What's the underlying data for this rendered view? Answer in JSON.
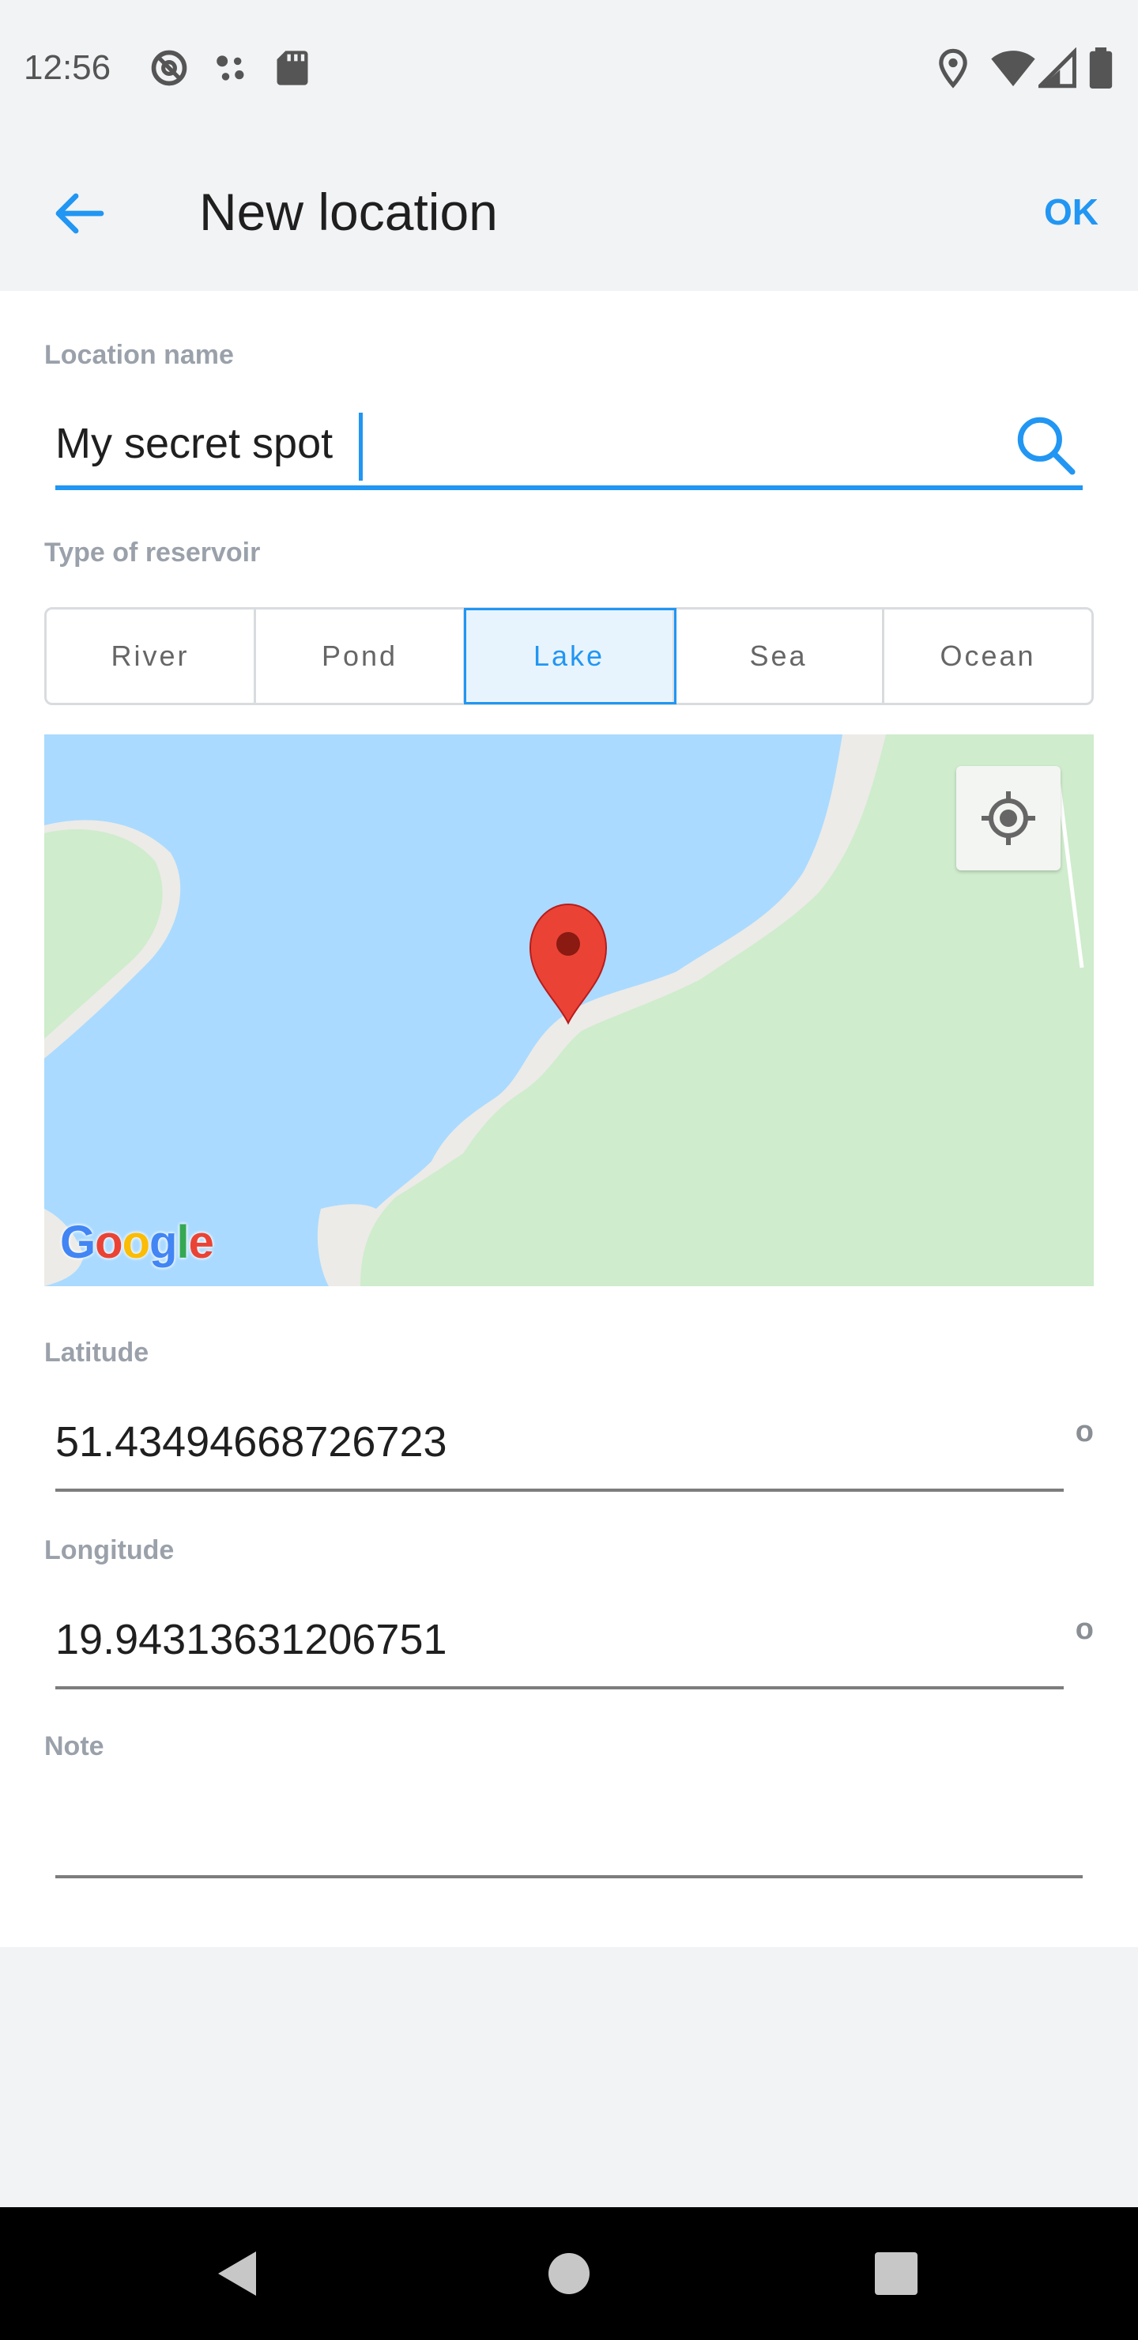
{
  "status": {
    "time": "12:56",
    "left_icons": [
      "at-sign-icon",
      "assistant-dots-icon",
      "sd-card-icon"
    ],
    "right_icons": [
      "location-pin-icon",
      "wifi-icon",
      "signal-icon",
      "battery-icon"
    ]
  },
  "header": {
    "title": "New location",
    "ok_label": "OK",
    "back_icon": "arrow-back-icon"
  },
  "form": {
    "name_label": "Location name",
    "name_value": "My secret spot",
    "reservoir_label": "Type of reservoir",
    "reservoir_types": [
      "River",
      "Pond",
      "Lake",
      "Sea",
      "Ocean"
    ],
    "reservoir_selected": "Lake",
    "latitude_label": "Latitude",
    "latitude_value": "51.43494668726723",
    "longitude_label": "Longitude",
    "longitude_value": "19.94313631206751",
    "degree_symbol": "o",
    "note_label": "Note",
    "note_value": ""
  },
  "map": {
    "logo_text": "Google",
    "water_color": "#aadaff",
    "land_color": "#cfeccd",
    "shore_color": "#ecebe7",
    "pin_color": "#ea4335"
  },
  "colors": {
    "accent": "#2196f3",
    "label_gray": "#9aa1aa"
  }
}
